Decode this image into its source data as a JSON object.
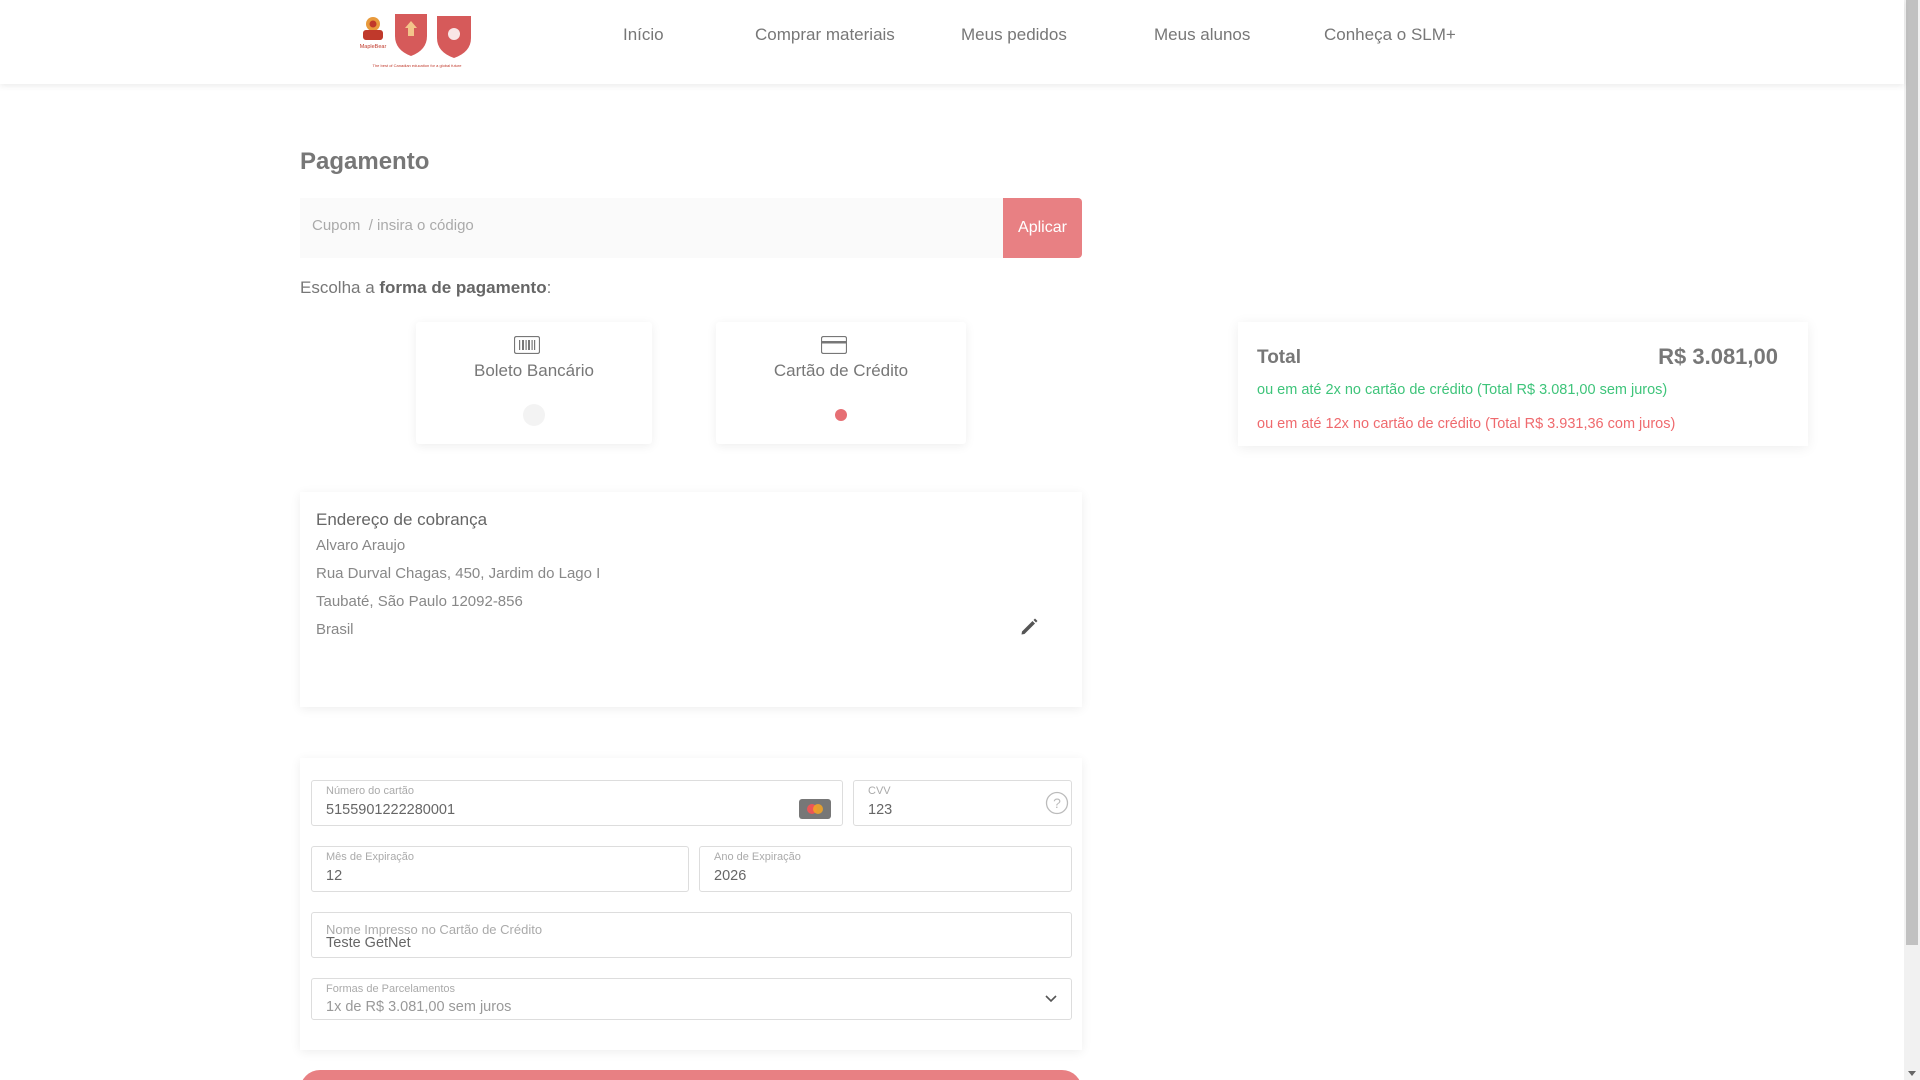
{
  "nav": {
    "items": [
      "Início",
      "Comprar materiais",
      "Meus pedidos",
      "Meus alunos",
      "Conheça o SLM+"
    ]
  },
  "logo": {
    "brand_text": "MapleBear",
    "tagline": "The best of Canadian education for a global future"
  },
  "page": {
    "title": "Pagamento"
  },
  "coupon": {
    "placeholder": "Cupom  / insira o código",
    "apply_label": "Aplicar"
  },
  "payment": {
    "choose_prefix": "Escolha a ",
    "choose_bold": "forma de pagamento",
    "choose_suffix": ":",
    "options": [
      {
        "label": "Boleto Bancário",
        "icon": "barcode-icon",
        "selected": false
      },
      {
        "label": "Cartão de Crédito",
        "icon": "credit-card-icon",
        "selected": true
      }
    ]
  },
  "summary": {
    "total_label": "Total",
    "total_value": "R$ 3.081,00",
    "installments_no_interest": "ou em até 2x no cartão de crédito (Total R$ 3.081,00 sem juros)",
    "installments_with_interest": "ou em até 12x no cartão de crédito (Total R$ 3.931,36 com juros)"
  },
  "address": {
    "title": "Endereço de cobrança",
    "name": "Alvaro Araujo",
    "street": "Rua Durval Chagas, 450, Jardim do Lago I",
    "city": "Taubaté, São Paulo 12092-856",
    "country": "Brasil"
  },
  "card_form": {
    "number_label": "Número do cartão",
    "number_value": "5155901222280001",
    "cvv_label": "CVV",
    "cvv_value": "123",
    "month_label": "Mês de Expiração",
    "month_value": "12",
    "year_label": "Ano de Expiração",
    "year_value": "2026",
    "name_label": "Nome Impresso no Cartão de Crédito",
    "name_value": "Teste GetNet",
    "installments_label": "Formas de Parcelamentos",
    "installments_value": "1x de R$ 3.081,00 sem juros"
  },
  "colors": {
    "accent": "#e88083",
    "green": "#3ec47a",
    "red": "#ef6a6e"
  }
}
